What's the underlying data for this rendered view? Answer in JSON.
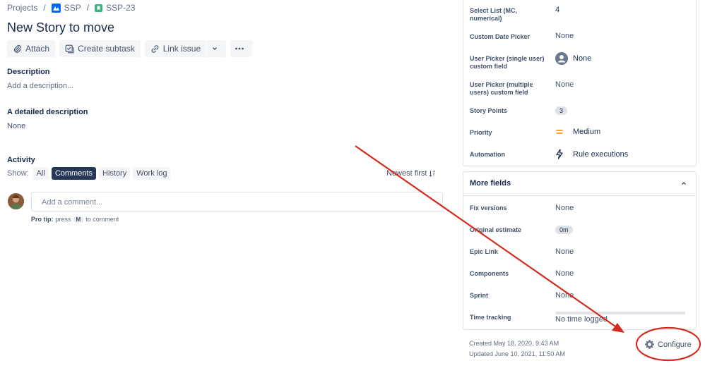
{
  "breadcrumb": {
    "projects": "Projects",
    "project": "SSP",
    "issue_key": "SSP-23",
    "separator": "/"
  },
  "issue": {
    "title": "New Story to move"
  },
  "toolbar": {
    "attach": "Attach",
    "create_subtask": "Create subtask",
    "link_issue": "Link issue",
    "more_icon": "ellipsis-icon"
  },
  "description": {
    "label": "Description",
    "placeholder": "Add a description..."
  },
  "detailed_description": {
    "label": "A detailed description",
    "value": "None"
  },
  "activity": {
    "label": "Activity",
    "show_label": "Show:",
    "filters": [
      "All",
      "Comments",
      "History",
      "Work log"
    ],
    "active_filter": "Comments",
    "sort_label": "Newest first",
    "comment_placeholder": "Add a comment...",
    "pro_tip_label": "Pro tip:",
    "pro_tip_press": "press",
    "pro_tip_key": "M",
    "pro_tip_suffix": "to comment"
  },
  "fields": [
    {
      "label": "Select List (MC, numerical)",
      "value": "4",
      "kind": "badge-plain"
    },
    {
      "label": "Custom Date Picker",
      "value": "None",
      "kind": "none"
    },
    {
      "label": "User Picker (single user) custom field",
      "value": "None",
      "kind": "user"
    },
    {
      "label": "User Picker (multiple users) custom field",
      "value": "None",
      "kind": "none"
    },
    {
      "label": "Story Points",
      "value": "3",
      "kind": "badge"
    },
    {
      "label": "Priority",
      "value": "Medium",
      "kind": "priority"
    },
    {
      "label": "Automation",
      "value": "Rule executions",
      "kind": "automation"
    }
  ],
  "more_fields": {
    "header": "More fields",
    "items": [
      {
        "label": "Fix versions",
        "value": "None",
        "kind": "none"
      },
      {
        "label": "Original estimate",
        "value": "0m",
        "kind": "badge"
      },
      {
        "label": "Epic Link",
        "value": "None",
        "kind": "none"
      },
      {
        "label": "Components",
        "value": "None",
        "kind": "none"
      },
      {
        "label": "Sprint",
        "value": "None",
        "kind": "none"
      },
      {
        "label": "Time tracking",
        "value": "No time logged",
        "kind": "tracking"
      }
    ]
  },
  "meta": {
    "created": "Created May 18, 2020, 9:43 AM",
    "updated": "Updated June 10, 2021, 11:50 AM"
  },
  "configure": {
    "label": "Configure",
    "icon": "gear-icon"
  },
  "colors": {
    "annotation_red": "#d42b1e",
    "priority_orange": "#ff991f",
    "active_chip": "#253858"
  }
}
